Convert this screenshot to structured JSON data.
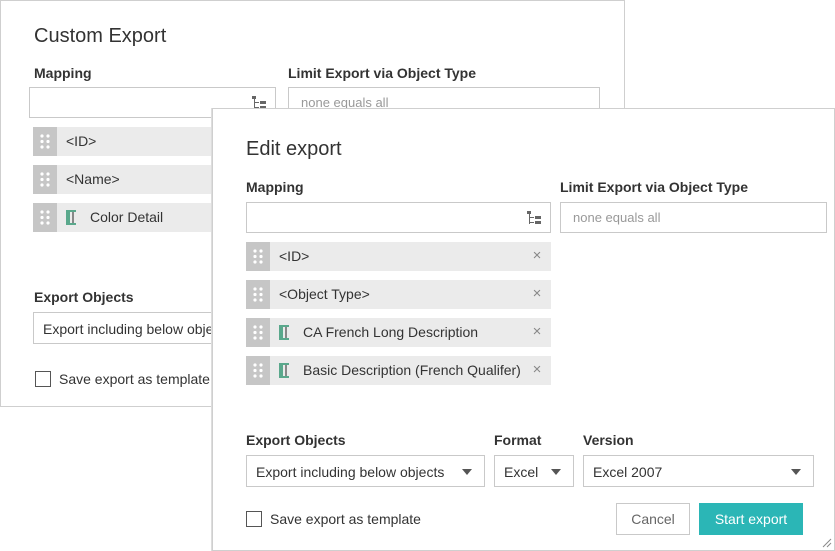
{
  "back_dialog": {
    "title": "Custom Export",
    "mapping_label": "Mapping",
    "limit_label": "Limit Export via Object Type",
    "limit_placeholder": "none equals all",
    "items": [
      {
        "label": "<ID>"
      },
      {
        "label": "<Name>"
      },
      {
        "label": "Color Detail",
        "icon": "attribute-icon"
      }
    ],
    "export_objects_label": "Export Objects",
    "export_objects_value": "Export including below obje",
    "save_template_label": "Save export as template"
  },
  "front_dialog": {
    "title": "Edit export",
    "mapping_label": "Mapping",
    "limit_label": "Limit Export via Object Type",
    "limit_placeholder": "none equals all",
    "items": [
      {
        "label": "<ID>"
      },
      {
        "label": "<Object Type>"
      },
      {
        "label": "CA French Long Description",
        "icon": "attribute-icon"
      },
      {
        "label": "Basic Description (French Qualifer)",
        "icon": "attribute-icon"
      }
    ],
    "remove_glyph": "×",
    "export_objects_label": "Export Objects",
    "export_objects_value": "Export including below objects",
    "format_label": "Format",
    "format_value": "Excel",
    "version_label": "Version",
    "version_value": "Excel 2007",
    "save_template_label": "Save export as template",
    "cancel_label": "Cancel",
    "start_label": "Start export"
  },
  "colors": {
    "accent": "#2bb6b6",
    "grip": "#c6c6c6",
    "item_bg": "#ebebeb",
    "attr_icon": "#5aa88c"
  }
}
